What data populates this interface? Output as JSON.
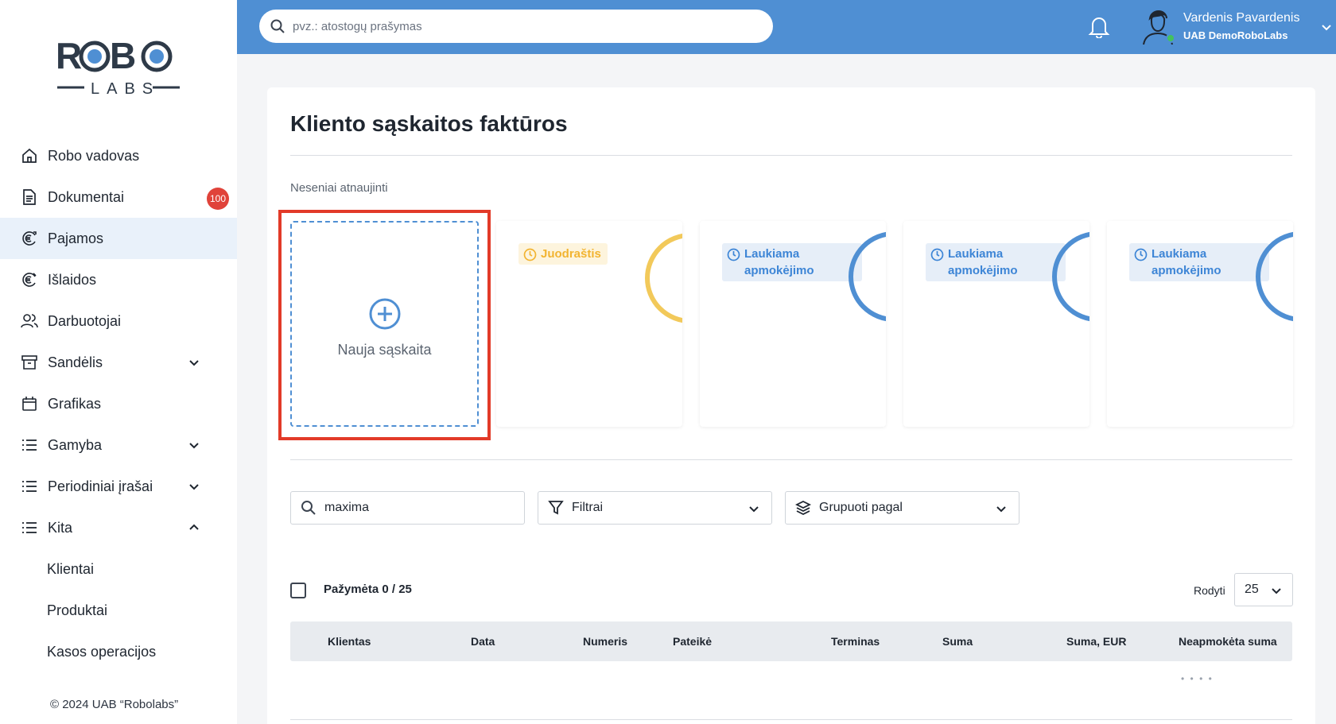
{
  "logo": {
    "line1": "ROBO",
    "line2": "LABS"
  },
  "sidebar": {
    "items": [
      {
        "label": "Robo vadovas",
        "icon": "home-icon"
      },
      {
        "label": "Dokumentai",
        "icon": "document-icon",
        "badge": "100"
      },
      {
        "label": "Pajamos",
        "icon": "euro-in-icon",
        "active": true
      },
      {
        "label": "Išlaidos",
        "icon": "euro-out-icon"
      },
      {
        "label": "Darbuotojai",
        "icon": "users-icon"
      },
      {
        "label": "Sandėlis",
        "icon": "archive-icon",
        "expand": "down"
      },
      {
        "label": "Grafikas",
        "icon": "calendar-icon"
      },
      {
        "label": "Gamyba",
        "icon": "list-icon",
        "expand": "down"
      },
      {
        "label": "Periodiniai įrašai",
        "icon": "list-icon",
        "expand": "down"
      },
      {
        "label": "Kita",
        "icon": "list-icon",
        "expand": "up"
      }
    ],
    "subitems": [
      {
        "label": "Klientai"
      },
      {
        "label": "Produktai"
      },
      {
        "label": "Kasos operacijos"
      }
    ],
    "copyright": "© 2024 UAB “Robolabs”"
  },
  "topbar": {
    "search_placeholder": "pvz.: atostogų prašymas",
    "user_name": "Vardenis Pavardenis",
    "user_company": "UAB DemoRoboLabs"
  },
  "main": {
    "title": "Kliento sąskaitos faktūros",
    "recent_label": "Neseniai atnaujinti",
    "new_invoice_label": "Nauja sąskaita",
    "recent_cards": [
      {
        "status": "Juodraštis",
        "kind": "draft"
      },
      {
        "status": "Laukiama apmokėjimo",
        "kind": "wait"
      },
      {
        "status": "Laukiama apmokėjimo",
        "kind": "wait"
      },
      {
        "status": "Laukiama apmokėjimo",
        "kind": "wait"
      }
    ],
    "search_value": "maxima",
    "filters_label": "Filtrai",
    "group_label": "Grupuoti pagal",
    "selected_text": "Pažymėta 0 / 25",
    "show_label": "Rodyti",
    "page_size": "25",
    "columns": [
      "Klientas",
      "Data",
      "Numeris",
      "Pateikė",
      "Terminas",
      "Suma",
      "Suma, EUR",
      "Neapmokėta suma"
    ]
  },
  "colors": {
    "brand_blue": "#4f8fd3",
    "draft_yellow": "#f2b431",
    "badge_red": "#e0433a",
    "highlight_red": "#e23a28"
  }
}
